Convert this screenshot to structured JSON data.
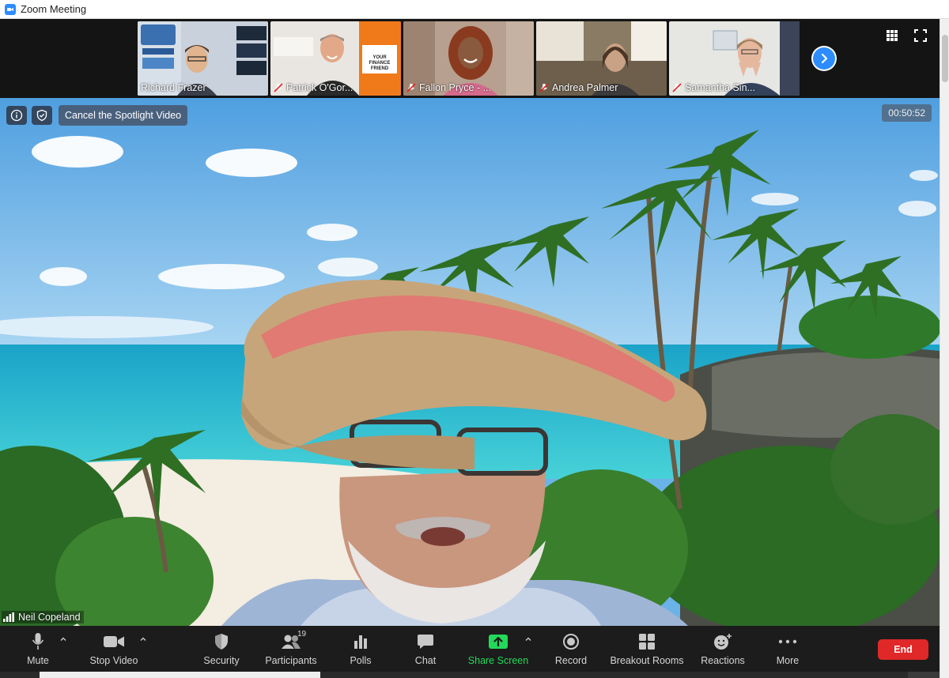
{
  "window": {
    "title": "Zoom Meeting"
  },
  "participants_strip": {
    "tiles": [
      {
        "name": "Richard Frazer",
        "muted": false
      },
      {
        "name": "Patrick O'Gor...",
        "muted": true
      },
      {
        "name": "Fallon Pryce - ...",
        "muted": true
      },
      {
        "name": "Andrea Palmer",
        "muted": true
      },
      {
        "name": "Samantha Sin...",
        "muted": true
      }
    ],
    "next_icon": "chevron-right-icon",
    "view_icon": "grid-icon",
    "fullscreen_icon": "fullscreen-icon"
  },
  "main_video": {
    "spotlight_label": "Cancel the Spotlight Video",
    "timer": "00:50:52",
    "speaker_name": "Neil Copeland"
  },
  "toolbar": {
    "mute": "Mute",
    "stop_video": "Stop Video",
    "security": "Security",
    "participants": "Participants",
    "participants_count": "19",
    "polls": "Polls",
    "chat": "Chat",
    "share_screen": "Share Screen",
    "record": "Record",
    "breakout_rooms": "Breakout Rooms",
    "reactions": "Reactions",
    "more": "More",
    "end": "End"
  },
  "colors": {
    "accent": "#2d8cff",
    "share_green": "#23d959",
    "end_red": "#e02828",
    "toolbar_bg": "#1c1c1c"
  }
}
